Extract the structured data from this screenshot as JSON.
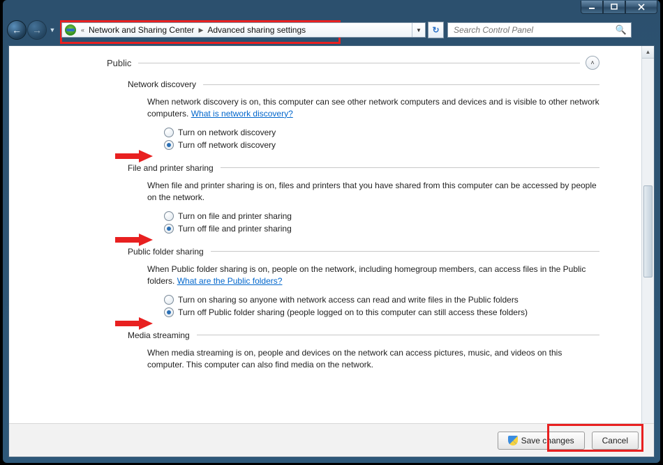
{
  "breadcrumb": {
    "parent": "Network and Sharing Center",
    "current": "Advanced sharing settings"
  },
  "search": {
    "placeholder": "Search Control Panel"
  },
  "profile": {
    "name": "Public"
  },
  "sections": {
    "network_discovery": {
      "title": "Network discovery",
      "desc_pre": "When network discovery is on, this computer can see other network computers and devices and is visible to other network computers. ",
      "link": "What is network discovery?",
      "opt_on": "Turn on network discovery",
      "opt_off": "Turn off network discovery"
    },
    "file_printer": {
      "title": "File and printer sharing",
      "desc": "When file and printer sharing is on, files and printers that you have shared from this computer can be accessed by people on the network.",
      "opt_on": "Turn on file and printer sharing",
      "opt_off": "Turn off file and printer sharing"
    },
    "public_folder": {
      "title": "Public folder sharing",
      "desc_pre": "When Public folder sharing is on, people on the network, including homegroup members, can access files in the Public folders. ",
      "link": "What are the Public folders?",
      "opt_on": "Turn on sharing so anyone with network access can read and write files in the Public folders",
      "opt_off": "Turn off Public folder sharing (people logged on to this computer can still access these folders)"
    },
    "media_streaming": {
      "title": "Media streaming",
      "desc": "When media streaming is on, people and devices on the network can access pictures, music, and videos on this computer. This computer can also find media on the network."
    }
  },
  "footer": {
    "save": "Save changes",
    "cancel": "Cancel"
  }
}
